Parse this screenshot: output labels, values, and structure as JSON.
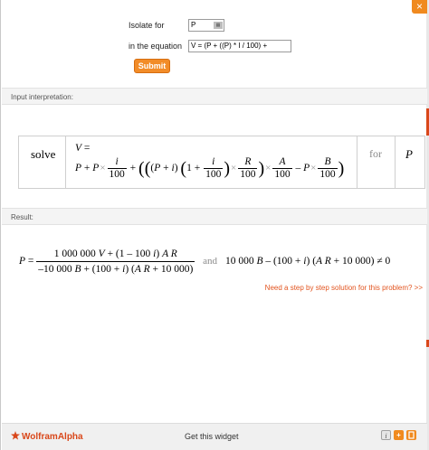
{
  "window": {
    "close_label": "×"
  },
  "form": {
    "isolate_label": "Isolate for",
    "variable_value": "P",
    "equation_label": "in the equation",
    "equation_value": "V = (P + ((P) * I / 100) +",
    "submit_label": "Submit"
  },
  "interpretation": {
    "section_label": "Input interpretation:",
    "solve_label": "solve",
    "for_label": "for",
    "variable": "P"
  },
  "result": {
    "section_label": "Result:",
    "and_label": "and",
    "step_link": "Need a step by step solution for this problem? >>"
  },
  "footer": {
    "brand": "WolframAlpha",
    "get_widget": "Get this widget",
    "info_icon": "i",
    "plus_icon": "+"
  },
  "colors": {
    "accent": "#f28c28",
    "brand": "#d9471a"
  }
}
